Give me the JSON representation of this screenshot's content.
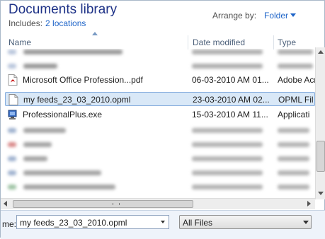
{
  "header": {
    "title": "Documents library",
    "includes_label": "Includes:",
    "locations_link": "2 locations",
    "arrange_label": "Arrange by:",
    "arrange_value": "Folder"
  },
  "columns": [
    {
      "label": "Name"
    },
    {
      "label": "Date modified"
    },
    {
      "label": "Type"
    }
  ],
  "files": [
    {
      "name": "Microsoft Office Profession...pdf",
      "date": "06-03-2010 AM 01...",
      "type": "Adobe Acr",
      "icon": "pdf-icon"
    },
    {
      "name": "my feeds_23_03_2010.opml",
      "date": "23-03-2010 AM 02...",
      "type": "OPML Fil",
      "icon": "document-icon",
      "selected": true
    },
    {
      "name": "ProfessionalPlus.exe",
      "date": "15-03-2010 AM 11...",
      "type": "Applicati",
      "icon": "installer-icon"
    }
  ],
  "footer": {
    "filename_label": "me:",
    "filename_value": "my feeds_23_03_2010.opml",
    "filter_value": "All Files"
  },
  "colors": {
    "title": "#1e3287",
    "link": "#1e64c8",
    "selection": "#d9e8f7"
  }
}
